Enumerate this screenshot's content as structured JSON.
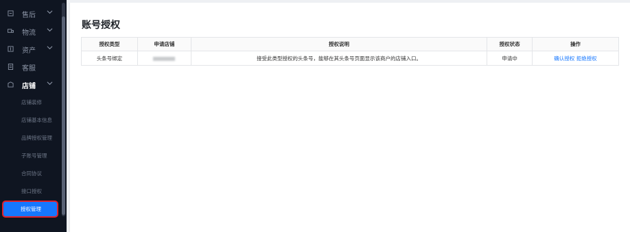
{
  "sidebar": {
    "groups": [
      {
        "label": "售后",
        "icon": "service-icon"
      },
      {
        "label": "物流",
        "icon": "truck-icon"
      },
      {
        "label": "资产",
        "icon": "wallet-icon"
      },
      {
        "label": "客服",
        "icon": "headset-icon"
      },
      {
        "label": "店铺",
        "icon": "store-icon"
      }
    ],
    "store_items": [
      {
        "label": "店铺装修"
      },
      {
        "label": "店铺基本信息"
      },
      {
        "label": "品牌授权管理"
      },
      {
        "label": "子账号管理"
      },
      {
        "label": "合同协议"
      },
      {
        "label": "接口授权"
      },
      {
        "label": "授权管理"
      }
    ]
  },
  "page": {
    "title": "账号授权"
  },
  "table": {
    "headers": [
      "授权类型",
      "申请店铺",
      "授权说明",
      "授权状态",
      "操作"
    ],
    "rows": [
      {
        "type": "头条号绑定",
        "store": "",
        "description": "接受此类型授权的头条号，能够在其头条号页面显示该商户的店铺入口。",
        "status": "申请中",
        "action_confirm": "确认授权",
        "action_reject": "拒绝授权"
      }
    ]
  },
  "colors": {
    "sidebar_bg": "#0f1521",
    "accent": "#1677ff",
    "highlight_border": "#e0202a"
  }
}
